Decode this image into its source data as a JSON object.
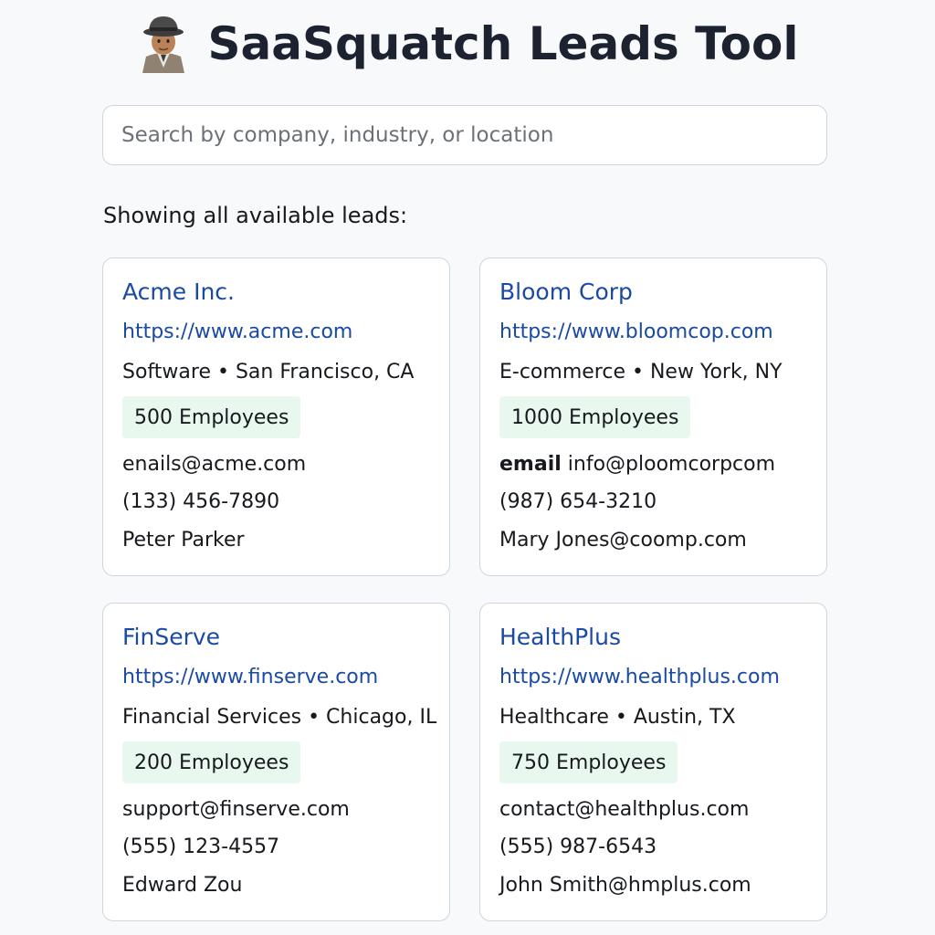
{
  "header": {
    "title": "SaaSquatch Leads Tool",
    "logo_icon": "detective-icon"
  },
  "search": {
    "placeholder": "Search by company, industry, or location",
    "value": ""
  },
  "status": {
    "text": "Showing all available leads:"
  },
  "colors": {
    "link": "#1a4aa3",
    "badge_bg": "#e9f8ee",
    "card_border": "#cfd6dd",
    "page_bg": "#f8f9fa"
  },
  "leads": [
    {
      "name": "Acme Inc.",
      "url": "https://www.acme.com",
      "meta": "Software • San Francisco, CA",
      "employees": "500 Employees",
      "email_label": "",
      "email": "enails@acme.com",
      "phone": "(133) 456-7890",
      "contact": "Peter Parker"
    },
    {
      "name": "Bloom Corp",
      "url": "https://www.bloomcop.com",
      "meta": "E-commerce • New York, NY",
      "employees": "1000 Employees",
      "email_label": "email",
      "email": "info@ploomcorpcom",
      "phone": "(987) 654-3210",
      "contact": "Mary Jones@coomp.com"
    },
    {
      "name": "FinServe",
      "url": "https://www.finserve.com",
      "meta": "Financial Services • Chicago, IL",
      "employees": "200 Employees",
      "email_label": "",
      "email": "support@finserve.com",
      "phone": "(555) 123-4557",
      "contact": "Edward Zou"
    },
    {
      "name": "HealthPlus",
      "url": "https://www.healthplus.com",
      "meta": "Healthcare • Austin, TX",
      "employees": "750 Employees",
      "email_label": "",
      "email": "contact@healthplus.com",
      "phone": "(555) 987-6543",
      "contact": "John Smith@hmplus.com"
    }
  ]
}
